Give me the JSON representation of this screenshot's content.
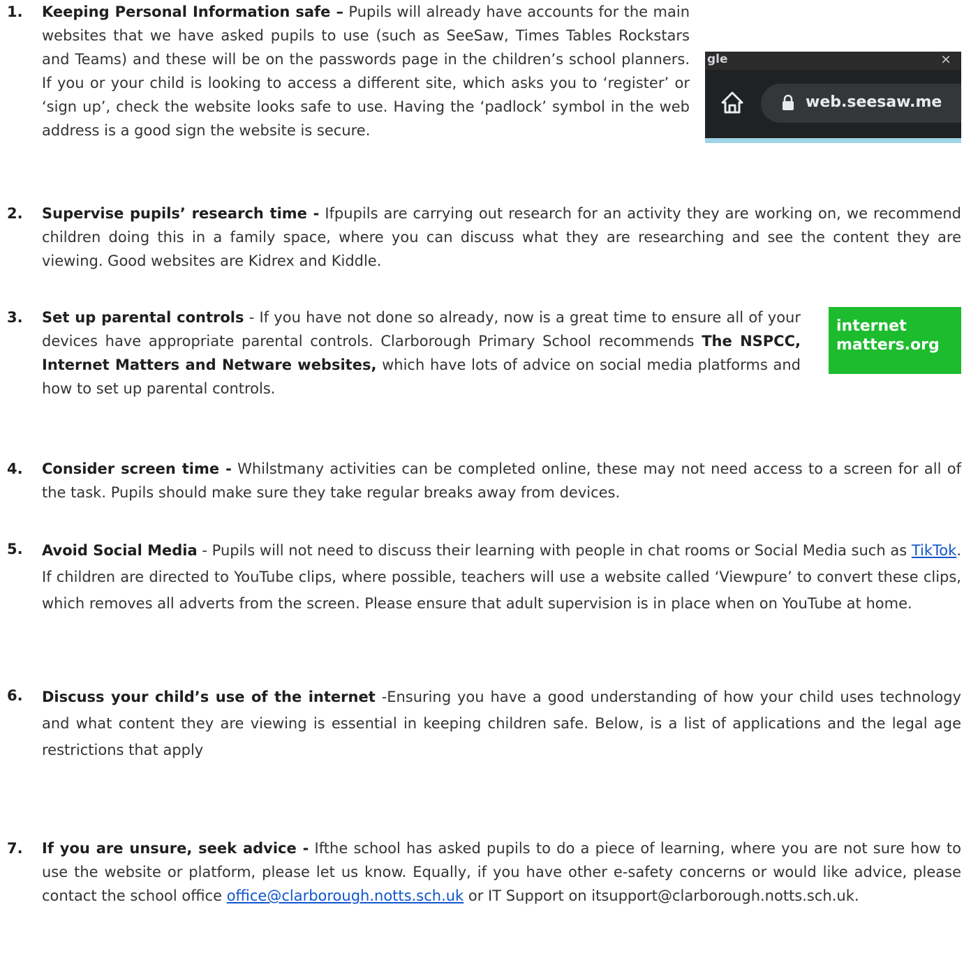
{
  "items": [
    {
      "number": "1.",
      "heading": "Keeping Personal Information safe –",
      "text": " Pupils will already have accounts for the main websites that we have asked pupils to use (such as SeeSaw, Times Tables Rockstars and Teams) and these will be on the passwords page in the children’s school planners. If you or your child is looking to access a different site, which asks you to ‘register’ or ‘sign up’, check the website looks safe to use. Having the ‘padlock’ symbol in the web address is a good sign the website is secure.",
      "figure": {
        "tab_fragment": "gle",
        "close_glyph": "×",
        "url": "web.seesaw.me",
        "home_icon": "home-icon",
        "lock_icon": "padlock-icon"
      }
    },
    {
      "number": "2.",
      "heading": "Supervise pupils’ research time -",
      "text": " Ifpupils are carrying out research for an activity they are working on, we recommend children doing this in a family space, where you can discuss what they are researching and see the content they are viewing. Good websites are Kidrex and Kiddle."
    },
    {
      "number": "3.",
      "heading": "Set up parental controls",
      "text_before": " - If you have not done so already, now is a great time to ensure all of your devices have appropriate parental controls. Clarborough Primary School recommends ",
      "emphasis": "The NSPCC, Internet Matters and Netware websites,",
      "text_after": " which have lots of advice on social media platforms and how to set up parental controls.",
      "figure": {
        "logo_line_1": "internet",
        "logo_line_2": "matters.org",
        "logo_color": "#1cbc2e"
      }
    },
    {
      "number": "4.",
      "heading": "Consider screen time -",
      "text": " Whilstmany activities can be completed online, these may not need access to a screen for all of the task. Pupils should make sure they take regular breaks away from devices."
    },
    {
      "number": "5.",
      "heading": "Avoid Social Media",
      "text_before": " - Pupils will not need to discuss their learning with people in chat rooms or Social Media such as ",
      "link": "TikTok",
      "text_after": ". If children are directed to YouTube clips, where possible, teachers will use a website called ‘Viewpure’ to convert these clips, which removes all adverts from the screen. Please ensure that adult supervision is in place when on YouTube at home."
    },
    {
      "number": "6.",
      "heading": "Discuss your child’s use of the internet",
      "text": " -Ensuring you have a good understanding of how your child uses technology and what content they are viewing is essential in keeping children safe. Below, is a list of applications and the legal age restrictions that apply"
    },
    {
      "number": "7.",
      "heading": "If you are unsure, seek advice -",
      "text_before": " Ifthe school has asked pupils to do a piece of learning, where you are not sure how to use the website or platform, please let us know. Equally, if you have other e-safety concerns or would like advice, please contact the school office ",
      "link": "office@clarborough.notts.sch.uk",
      "text_after": " or IT Support on itsupport@clarborough.notts.sch.uk."
    }
  ],
  "colors": {
    "body_text": "#333333",
    "heading_text": "#1f1f1f",
    "link": "#1155cc"
  }
}
